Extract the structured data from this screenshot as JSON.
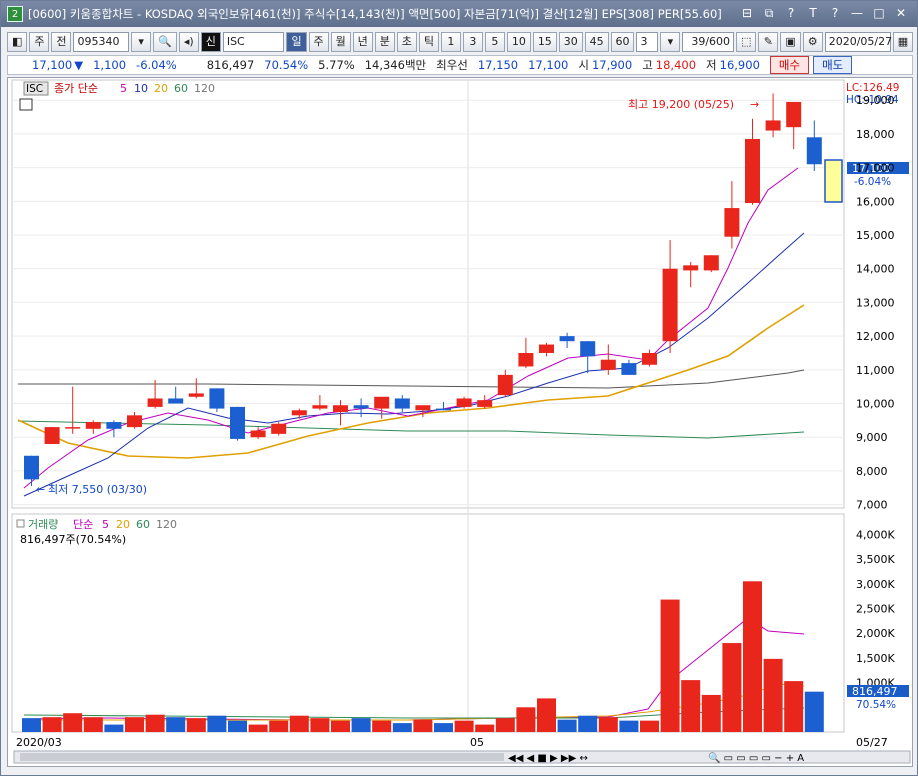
{
  "window": {
    "title": "[0600] 키움종합차트 - KOSDAQ 외국인보유[461(천)] 주식수[14,143(천)] 액면[500] 자본금[71(억)] 결산[12월] EPS[308] PER[55.60]",
    "badge": "2",
    "controls": [
      "⊟",
      "⧉",
      "?",
      "T",
      "?",
      "—",
      "□",
      "✕"
    ]
  },
  "toolbar": {
    "period_label": "주",
    "all_label": "전",
    "code": "095340",
    "stock_flag": "신",
    "stock_name": "ISC",
    "tf_day": "일",
    "tf_week": "주",
    "tf_month": "월",
    "tf_year": "년",
    "tf_min": "분",
    "tf_sec": "초",
    "tf_tick": "틱",
    "min_opts": [
      "1",
      "3",
      "5",
      "10",
      "15",
      "30",
      "45",
      "60"
    ],
    "interval": "3",
    "count": "39/600",
    "date": "2020/05/27"
  },
  "quote": {
    "price": "17,100",
    "arrow": "▼",
    "change": "1,100",
    "pct": "-6.04%",
    "volume": "816,497",
    "vol_pct": "70.54%",
    "turnover": "5.77%",
    "amount": "14,346백만",
    "best": "최우선",
    "bid1": "17,150",
    "bid2": "17,100",
    "open_label": "시",
    "open": "17,900",
    "high_label": "고",
    "high": "18,400",
    "low_label": "저",
    "low": "16,900",
    "buy": "매수",
    "sell": "매도"
  },
  "price_panel": {
    "tag": "ISC",
    "legend_label": "종가 단순",
    "ma_periods": [
      "5",
      "10",
      "20",
      "60",
      "120"
    ],
    "ma_colors": [
      "#c000c0",
      "#1a2fb0",
      "#e0a000",
      "#2e8b57",
      "#555555"
    ],
    "lc": "LC:126.49",
    "hc": "HC:-10.94",
    "high_note": "최고 19,200 (05/25)",
    "low_note": "최저 7,550 (03/30)",
    "last_price_tag": "17,100",
    "last_pct_tag": "-6.04%",
    "y_ticks": [
      "19,000",
      "18,000",
      "17,000",
      "16,000",
      "15,000",
      "14,000",
      "13,000",
      "12,000",
      "11,000",
      "10,000",
      "9,000",
      "8,000",
      "7,000"
    ]
  },
  "volume_panel": {
    "legend_label": "거래량",
    "legend_ma": "단순",
    "ma_periods": [
      "5",
      "20",
      "60",
      "120"
    ],
    "sub": "816,497주(70.54%)",
    "y_ticks": [
      "4,000K",
      "3,500K",
      "3,000K",
      "2,500K",
      "2,000K",
      "1,500K",
      "1,000K"
    ],
    "last_tag": "816,497",
    "last_pct": "70.54%"
  },
  "x_axis": {
    "start": "2020/03",
    "mid": "05",
    "end": "05/27"
  },
  "chart_data": {
    "type": "candlestick",
    "ylim": [
      7000,
      19200
    ],
    "candles": [
      {
        "o": 8450,
        "h": 8450,
        "l": 7550,
        "c": 7750
      },
      {
        "o": 8800,
        "h": 9300,
        "l": 8800,
        "c": 9300
      },
      {
        "o": 9300,
        "h": 10500,
        "l": 9100,
        "c": 9300
      },
      {
        "o": 9250,
        "h": 9500,
        "l": 9100,
        "c": 9450
      },
      {
        "o": 9450,
        "h": 9500,
        "l": 9000,
        "c": 9250
      },
      {
        "o": 9300,
        "h": 9750,
        "l": 9250,
        "c": 9650
      },
      {
        "o": 9900,
        "h": 10700,
        "l": 9850,
        "c": 10150
      },
      {
        "o": 10150,
        "h": 10500,
        "l": 10000,
        "c": 10000
      },
      {
        "o": 10200,
        "h": 10750,
        "l": 10150,
        "c": 10300
      },
      {
        "o": 10450,
        "h": 10450,
        "l": 9750,
        "c": 9850
      },
      {
        "o": 9900,
        "h": 9900,
        "l": 8900,
        "c": 8950
      },
      {
        "o": 9000,
        "h": 9300,
        "l": 8950,
        "c": 9200
      },
      {
        "o": 9100,
        "h": 9450,
        "l": 9050,
        "c": 9400
      },
      {
        "o": 9650,
        "h": 9850,
        "l": 9550,
        "c": 9800
      },
      {
        "o": 9850,
        "h": 10250,
        "l": 9800,
        "c": 9950
      },
      {
        "o": 9750,
        "h": 10100,
        "l": 9350,
        "c": 9950
      },
      {
        "o": 9950,
        "h": 10150,
        "l": 9600,
        "c": 9850
      },
      {
        "o": 9850,
        "h": 10000,
        "l": 9550,
        "c": 10200
      },
      {
        "o": 10150,
        "h": 10250,
        "l": 9750,
        "c": 9850
      },
      {
        "o": 9800,
        "h": 9850,
        "l": 9600,
        "c": 9950
      },
      {
        "o": 9850,
        "h": 10050,
        "l": 9800,
        "c": 9800
      },
      {
        "o": 9900,
        "h": 10200,
        "l": 9850,
        "c": 10150
      },
      {
        "o": 9900,
        "h": 10250,
        "l": 9850,
        "c": 10100
      },
      {
        "o": 10250,
        "h": 11000,
        "l": 10200,
        "c": 10850
      },
      {
        "o": 11100,
        "h": 11950,
        "l": 11050,
        "c": 11500
      },
      {
        "o": 11500,
        "h": 11800,
        "l": 11400,
        "c": 11750
      },
      {
        "o": 12000,
        "h": 12100,
        "l": 11650,
        "c": 11850
      },
      {
        "o": 11850,
        "h": 11850,
        "l": 10900,
        "c": 11400
      },
      {
        "o": 11000,
        "h": 11750,
        "l": 10850,
        "c": 11300
      },
      {
        "o": 11200,
        "h": 11300,
        "l": 10850,
        "c": 10850
      },
      {
        "o": 11150,
        "h": 11600,
        "l": 11100,
        "c": 11500
      },
      {
        "o": 11850,
        "h": 14850,
        "l": 11500,
        "c": 14000
      },
      {
        "o": 13950,
        "h": 14200,
        "l": 13450,
        "c": 14100
      },
      {
        "o": 13950,
        "h": 14400,
        "l": 13900,
        "c": 14400
      },
      {
        "o": 14950,
        "h": 16600,
        "l": 14600,
        "c": 15800
      },
      {
        "o": 15950,
        "h": 18450,
        "l": 15900,
        "c": 17850
      },
      {
        "o": 18100,
        "h": 19200,
        "l": 17900,
        "c": 18400
      },
      {
        "o": 18200,
        "h": 18850,
        "l": 17550,
        "c": 18950
      },
      {
        "o": 17900,
        "h": 18400,
        "l": 16900,
        "c": 17100
      }
    ],
    "volumes": [
      280,
      300,
      380,
      300,
      150,
      300,
      350,
      300,
      280,
      330,
      230,
      150,
      230,
      330,
      280,
      230,
      280,
      230,
      180,
      250,
      180,
      230,
      150,
      280,
      500,
      680,
      250,
      330,
      300,
      230,
      230,
      2680,
      1050,
      750,
      1800,
      3050,
      1480,
      1030,
      816
    ]
  }
}
